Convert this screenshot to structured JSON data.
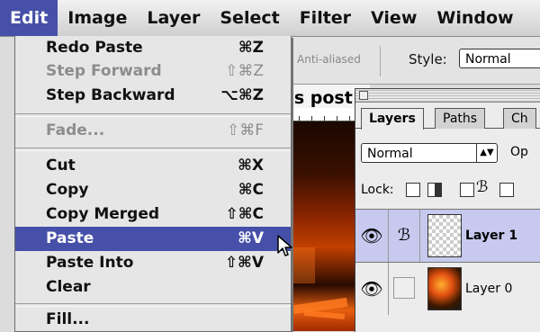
{
  "menubar": {
    "items": [
      "Edit",
      "Image",
      "Layer",
      "Select",
      "Filter",
      "View",
      "Window"
    ]
  },
  "edit_menu": {
    "items": [
      {
        "label": "Redo Paste",
        "shortcut": "⌘Z",
        "enabled": true
      },
      {
        "label": "Step Forward",
        "shortcut": "⇧⌘Z",
        "enabled": false
      },
      {
        "label": "Step Backward",
        "shortcut": "⌥⌘Z",
        "enabled": true
      },
      {
        "label": "Fade...",
        "shortcut": "⇧⌘F",
        "enabled": false
      },
      {
        "label": "Cut",
        "shortcut": "⌘X",
        "enabled": true
      },
      {
        "label": "Copy",
        "shortcut": "⌘C",
        "enabled": true
      },
      {
        "label": "Copy Merged",
        "shortcut": "⇧⌘C",
        "enabled": true
      },
      {
        "label": "Paste",
        "shortcut": "⌘V",
        "enabled": true,
        "highlighted": true
      },
      {
        "label": "Paste Into",
        "shortcut": "⇧⌘V",
        "enabled": true
      },
      {
        "label": "Clear",
        "shortcut": "",
        "enabled": true
      },
      {
        "label": "Fill...",
        "shortcut": "",
        "enabled": true
      }
    ]
  },
  "options_bar": {
    "anti_aliased": "Anti-aliased",
    "style_label": "Style:",
    "style_value": "Normal"
  },
  "document": {
    "title_fragment": "'s post"
  },
  "layers_palette": {
    "tabs": [
      "Layers",
      "Paths",
      "Ch"
    ],
    "active_tab": "Layers",
    "blend_mode": "Normal",
    "opacity_label": "Op",
    "lock_label": "Lock:",
    "layers": [
      {
        "name": "Layer 1",
        "selected": true,
        "visible": true,
        "thumbnail": "transparent"
      },
      {
        "name": "Layer 0",
        "selected": false,
        "visible": true,
        "thumbnail": "image"
      }
    ]
  },
  "colors": {
    "menu_highlight": "#4650a8",
    "layer_selected": "#c7c9ee"
  }
}
